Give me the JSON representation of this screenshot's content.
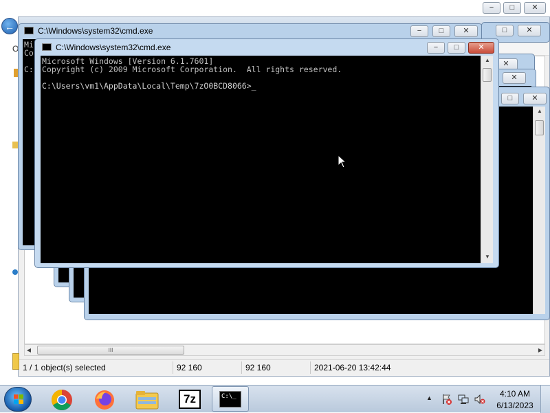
{
  "background_window": {
    "title": "C:\\Windows\\system32\\cmd.exe",
    "partial_menu_letter": "O",
    "controls": {
      "minimize": "−",
      "maximize": "□",
      "close": "✕"
    },
    "scrollbar_thumb_grip": "III",
    "status": {
      "selection": "1 / 1 object(s) selected",
      "size": "92 160",
      "packed_size": "92 160",
      "modified": "2021-06-20 13:42:44"
    }
  },
  "cmd_windows": {
    "back1": {
      "title": "C:\\Windows\\system32\\cmd.exe",
      "text": "Mi\nCo\n\nC:"
    },
    "main": {
      "title": "C:\\Windows\\system32\\cmd.exe",
      "icon_text": "C:\\",
      "lines": [
        "Microsoft Windows [Version 6.1.7601]",
        "Copyright (c) 2009 Microsoft Corporation.  All rights reserved.",
        "",
        "C:\\Users\\vm1\\AppData\\Local\\Temp\\7zO0BCD8066>_"
      ]
    }
  },
  "taskbar": {
    "apps": [
      {
        "name": "chrome-icon",
        "active": false
      },
      {
        "name": "firefox-icon",
        "active": false
      },
      {
        "name": "explorer-icon",
        "active": false
      },
      {
        "name": "7zip-icon",
        "label": "7z",
        "active": false
      },
      {
        "name": "cmd-icon",
        "label": "C:\\_",
        "active": true
      }
    ],
    "tray": [
      "show-hidden-icons-chevron",
      "action-center-icon",
      "network-icon",
      "volume-muted-icon"
    ],
    "clock_time": "4:10 AM",
    "clock_date": "6/13/2023"
  },
  "colors": {
    "console_bg": "#000000",
    "console_text": "#c0c0c0",
    "cmd_frame": "#b9d1ea",
    "close_red": "#c94c3a"
  }
}
